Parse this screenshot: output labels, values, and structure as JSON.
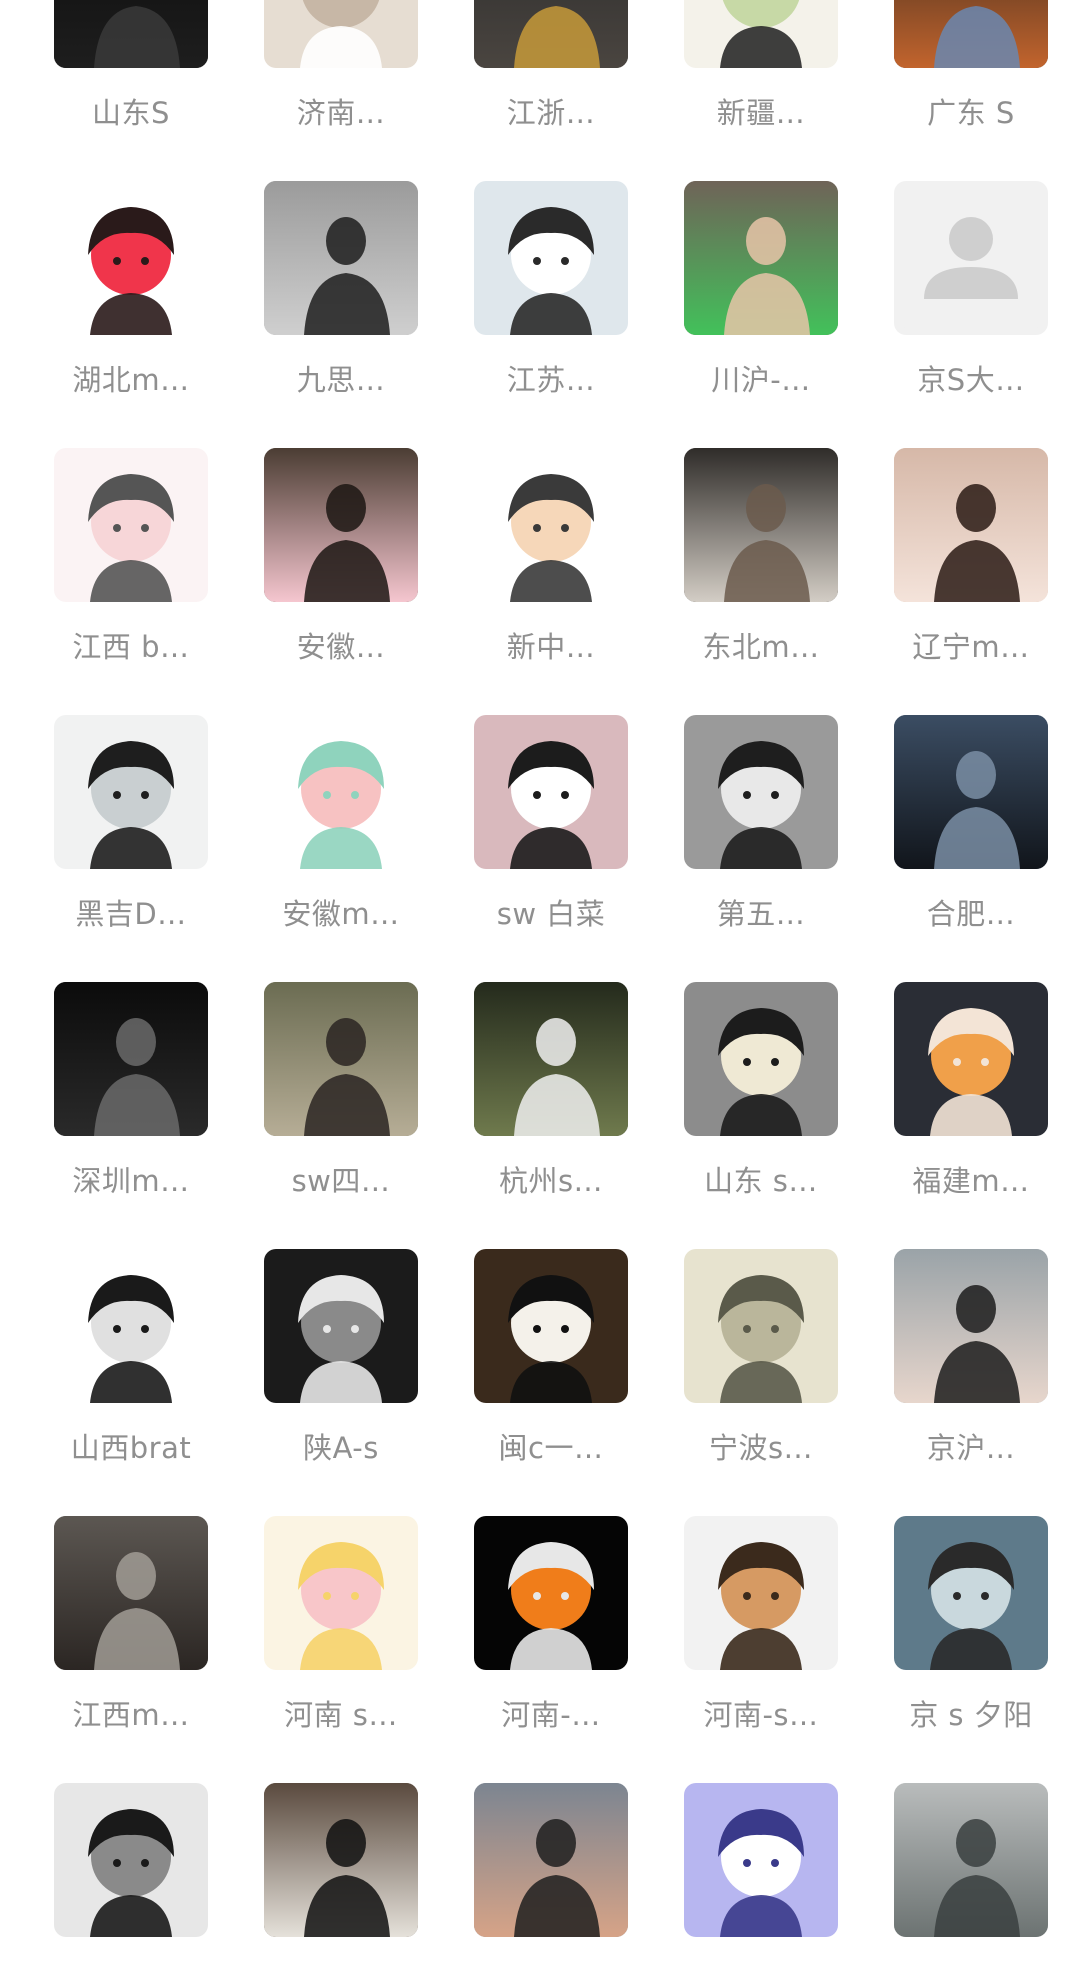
{
  "contacts": [
    {
      "name": "山东S",
      "avatar": "photo-dark",
      "colors": [
        "#0c0c0c",
        "#1e1e1e",
        "#3a3a3a"
      ]
    },
    {
      "name": "济南…",
      "avatar": "cat-photo",
      "colors": [
        "#e6ddd2",
        "#c7b7a6",
        "#ffffff"
      ]
    },
    {
      "name": "江浙…",
      "avatar": "photo-dark",
      "colors": [
        "#2b2b2b",
        "#4a4540",
        "#c79a3a"
      ]
    },
    {
      "name": "新疆…",
      "avatar": "illustration",
      "colors": [
        "#f4f2ea",
        "#c7d9a6",
        "#2a2a2a"
      ]
    },
    {
      "name": "广东  S",
      "avatar": "photo-street",
      "colors": [
        "#3a2a1e",
        "#c2642d",
        "#6a87b0"
      ]
    },
    {
      "name": "湖北m…",
      "avatar": "anime-girl",
      "colors": [
        "#ffffff",
        "#f0354b",
        "#2a1a1a"
      ]
    },
    {
      "name": "九思…",
      "avatar": "photo-smoke",
      "colors": [
        "#9b9b9b",
        "#cfcfcf",
        "#1d1d1d"
      ]
    },
    {
      "name": "江苏…",
      "avatar": "chibi",
      "colors": [
        "#dfe7ec",
        "#ffffff",
        "#2a2a2a"
      ]
    },
    {
      "name": "川沪-…",
      "avatar": "photo-baby",
      "colors": [
        "#6f6358",
        "#42c15a",
        "#e7c4a8"
      ]
    },
    {
      "name": "京S大…",
      "avatar": "default-avatar",
      "colors": [
        "#f1f1f1",
        "#cfcfcf",
        "#cfcfcf"
      ]
    },
    {
      "name": "江西 b…",
      "avatar": "hello-kitty",
      "colors": [
        "#fbf3f4",
        "#f7d6d8",
        "#555555"
      ]
    },
    {
      "name": "安徽…",
      "avatar": "photo-girl",
      "colors": [
        "#4b3d33",
        "#f5c6cf",
        "#1c1613"
      ]
    },
    {
      "name": "新中…",
      "avatar": "cartoon-cat",
      "colors": [
        "#ffffff",
        "#f6d7b9",
        "#3a3a3a"
      ]
    },
    {
      "name": "东北m…",
      "avatar": "photo-dark",
      "colors": [
        "#2f2c29",
        "#d3cdc5",
        "#6b5a4c"
      ]
    },
    {
      "name": "辽宁m…",
      "avatar": "photo-girl",
      "colors": [
        "#d6b8a8",
        "#f4e3da",
        "#2a1a14"
      ]
    },
    {
      "name": "黑吉D…",
      "avatar": "anime-boy",
      "colors": [
        "#f1f2f2",
        "#c9cfd1",
        "#1e1e1e"
      ]
    },
    {
      "name": "安徽m…",
      "avatar": "panda-bear",
      "colors": [
        "#ffffff",
        "#f7c2c2",
        "#8fd3bd"
      ]
    },
    {
      "name": "sw 白菜",
      "avatar": "anime-girl",
      "colors": [
        "#d9b9bd",
        "#ffffff",
        "#1c1c1c"
      ]
    },
    {
      "name": "第五…",
      "avatar": "anime-boy",
      "colors": [
        "#9a9a9a",
        "#e8e8e8",
        "#1e1e1e"
      ]
    },
    {
      "name": "合肥…",
      "avatar": "photo-dark",
      "colors": [
        "#3b4d63",
        "#11151b",
        "#7a8ea5"
      ]
    },
    {
      "name": "深圳m…",
      "avatar": "photo-dark",
      "colors": [
        "#0b0b0b",
        "#2a2a2a",
        "#6a6a6a"
      ]
    },
    {
      "name": "sw四…",
      "avatar": "photo-nature",
      "colors": [
        "#6b6c52",
        "#b6ad96",
        "#2a2422"
      ]
    },
    {
      "name": "杭州s…",
      "avatar": "photo-crocodile",
      "colors": [
        "#242a1c",
        "#6f7a4d",
        "#f0f0f0"
      ]
    },
    {
      "name": "山东 s…",
      "avatar": "anime-girl",
      "colors": [
        "#8c8c8c",
        "#efe9d4",
        "#1c1c1c"
      ]
    },
    {
      "name": "福建m…",
      "avatar": "anime-girl",
      "colors": [
        "#2a2d35",
        "#f0a04a",
        "#f3e4d6"
      ]
    },
    {
      "name": "山西brat",
      "avatar": "anime-girl",
      "colors": [
        "#ffffff",
        "#e0e0e0",
        "#1a1a1a"
      ]
    },
    {
      "name": "陕A-s",
      "avatar": "anime-boy",
      "colors": [
        "#1b1b1b",
        "#8a8a8a",
        "#e7e7e7"
      ]
    },
    {
      "name": "闽c一…",
      "avatar": "samoyed-dog",
      "colors": [
        "#3a2a1c",
        "#f4f1ea",
        "#111111"
      ]
    },
    {
      "name": "宁波s…",
      "avatar": "anime-boy",
      "colors": [
        "#e7e3cf",
        "#bab69b",
        "#5a5a4a"
      ]
    },
    {
      "name": "京沪…",
      "avatar": "photo-girl",
      "colors": [
        "#9aa3a8",
        "#e7d6cc",
        "#1c1c1c"
      ]
    },
    {
      "name": "江西m…",
      "avatar": "photo-dark",
      "colors": [
        "#5c5752",
        "#2b2623",
        "#a19c95"
      ]
    },
    {
      "name": "河南 s…",
      "avatar": "piglet",
      "colors": [
        "#fbf4e3",
        "#f8c6c9",
        "#f6d36a"
      ]
    },
    {
      "name": "河南-…",
      "avatar": "anime-boy",
      "colors": [
        "#050505",
        "#f07d1a",
        "#e7e7e7"
      ]
    },
    {
      "name": "河南-s…",
      "avatar": "capybara",
      "colors": [
        "#f2f2f2",
        "#d69a63",
        "#3b2a1c"
      ]
    },
    {
      "name": "京 s 夕阳",
      "avatar": "anime-girl",
      "colors": [
        "#5e7a8a",
        "#c9d8dd",
        "#2a2a2a"
      ]
    },
    {
      "name": "",
      "avatar": "cat-photo",
      "colors": [
        "#e7e7e7",
        "#8a8a8a",
        "#1a1a1a"
      ]
    },
    {
      "name": "",
      "avatar": "photo-girl",
      "colors": [
        "#5a4a3e",
        "#e5e1da",
        "#111111"
      ]
    },
    {
      "name": "",
      "avatar": "photo-sunset",
      "colors": [
        "#7c8591",
        "#d6a387",
        "#1f1f1f"
      ]
    },
    {
      "name": "",
      "avatar": "anime-girl",
      "colors": [
        "#b7b6f0",
        "#ffffff",
        "#3a3a8a"
      ]
    },
    {
      "name": "",
      "avatar": "photo-city",
      "colors": [
        "#b9bcbc",
        "#6c7372",
        "#3a3f3f"
      ]
    }
  ]
}
